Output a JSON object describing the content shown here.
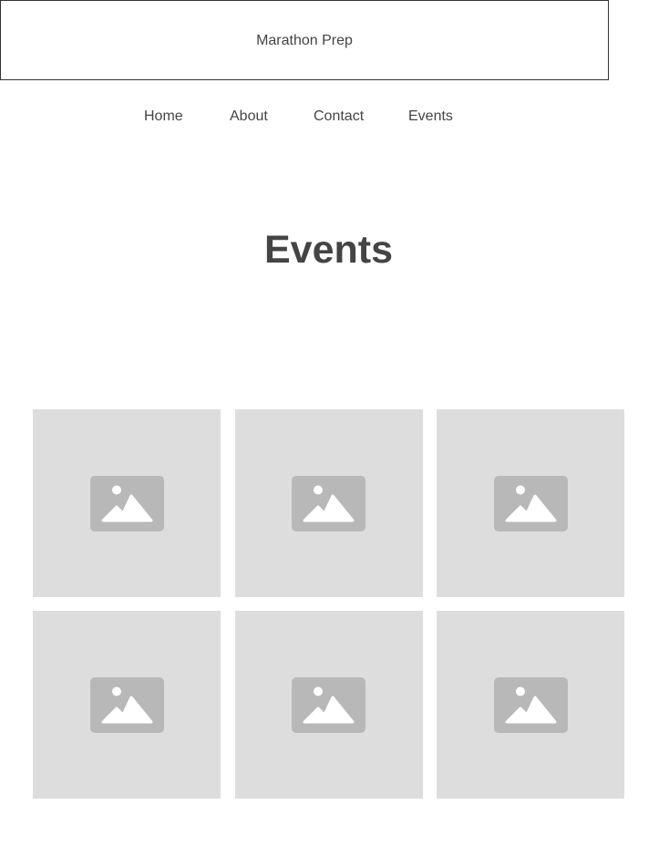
{
  "header": {
    "site_title": "Marathon Prep"
  },
  "nav": {
    "items": [
      {
        "label": "Home"
      },
      {
        "label": "About"
      },
      {
        "label": "Contact"
      },
      {
        "label": "Events"
      }
    ]
  },
  "main": {
    "page_title": "Events",
    "gallery": {
      "tile_count": 6,
      "placeholder_icon": "image-placeholder-icon",
      "tile_color": "#dddddd",
      "icon_color": "#b8b8b8"
    }
  }
}
